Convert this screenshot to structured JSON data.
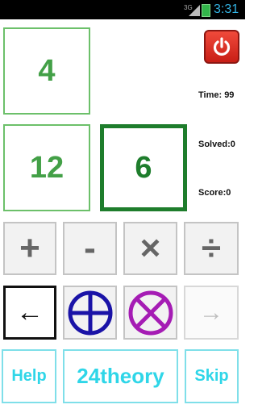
{
  "status_bar": {
    "network": "3G",
    "time": "3:31",
    "icons": [
      "signal-icon",
      "battery-icon"
    ]
  },
  "cards": {
    "top_left": "4",
    "middle_left": "12",
    "middle_right": "6"
  },
  "info": {
    "time": "Time: 99",
    "solved": "Solved:0",
    "score": "Score:0"
  },
  "operators": {
    "plus": "+",
    "minus": "-",
    "multiply": "×",
    "divide": "÷"
  },
  "actions": {
    "back": "←",
    "forward": "→"
  },
  "bottom": {
    "help": "Help",
    "title": "24theory",
    "skip": "Skip"
  },
  "colors": {
    "card_number": "#43a047",
    "selected_card": "#1e7d2c",
    "circle_plus": "#1a13a7",
    "circle_times": "#a51cb4",
    "bottom_text": "#2fd6e8"
  }
}
